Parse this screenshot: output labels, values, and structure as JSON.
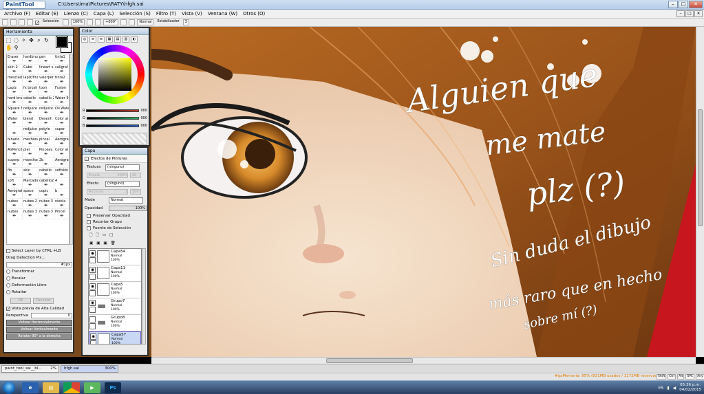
{
  "window": {
    "logo_text": "PaintTool SAI",
    "path": "C:\\Users\\ima\\Pictures\\RATY\\hfgh.sai"
  },
  "menu": [
    "Archivo (F)",
    "Editar (E)",
    "Lienzo (C)",
    "Capa (L)",
    "Selección (S)",
    "Filtro (T)",
    "Vista (V)",
    "Ventana (W)",
    "Otros (O)"
  ],
  "toolbar": {
    "selection_label": "Selección",
    "zoom": "100%",
    "rotation": "+000°",
    "mode": "Normal",
    "stabilizer_label": "Estabilizador",
    "stabilizer_value": "3"
  },
  "tools_panel": {
    "title": "Herramienta",
    "brushes": [
      [
        "Eraser",
        "hardbrus",
        "pen",
        "tinta1"
      ],
      [
        "skin 2",
        "Cubo",
        "lineart s",
        "caligraf Pen"
      ],
      [
        "mesclado",
        "lapiz/fino",
        "valorper",
        "tinta2"
      ],
      [
        "Lapiz",
        "fx brush",
        "toon",
        "Fusion"
      ],
      [
        "hard bru",
        "cabello",
        "cabello 2",
        "Water 9"
      ],
      [
        "Square Brush",
        "redjuice 2mm",
        "redjuice mic",
        "Oil Water"
      ],
      [
        "Water",
        "blend",
        "Desenf.",
        "Color al"
      ],
      [
        "",
        "redjuice",
        "petyle",
        "super"
      ],
      [
        "binario",
        "mechone",
        "pincel",
        "Aerógraf"
      ],
      [
        "AirPencil Pencil",
        "piel",
        "Pinceau",
        "Color al"
      ],
      [
        "superp",
        "manchas",
        "2b",
        "Aerógraf"
      ],
      [
        "fib",
        "skin",
        "cabello",
        "softskin"
      ],
      [
        "soft",
        "Marcado",
        "cabello2",
        "4"
      ],
      [
        "Aerógraf",
        "space",
        "copic",
        "b"
      ],
      [
        "nubes",
        "nubes 2",
        "nubes 3",
        "niebla"
      ],
      [
        "nubes",
        "nubes 3",
        "nubes 3",
        "Pincel"
      ]
    ],
    "select_layer_ctrl": "Select Layer by CTRL +LB",
    "drag_detection": "Drag Detection Pix...",
    "drag_value": "#1px",
    "transform_options": [
      "Transformar",
      "Escalar",
      "Deformación Libre",
      "Rotatiar"
    ],
    "ok": "OK",
    "cancel": "Cancelar",
    "hq_preview": "Vista previa de Alta Calidad",
    "perspective_label": "Perspectiva",
    "perspective_value": "0",
    "flip_h": "Voltear Horizontalmente",
    "flip_v": "Voltear Verticalmente",
    "rotate90": "Rotatar 90° a la derecha"
  },
  "color_panel": {
    "title": "Color",
    "rgb": [
      {
        "label": "R",
        "value": "000",
        "color": "#c0392b"
      },
      {
        "label": "G",
        "value": "000",
        "color": "#27ae60"
      },
      {
        "label": "B",
        "value": "000",
        "color": "#2c5fbf"
      }
    ]
  },
  "layer_panel": {
    "title": "Capa",
    "effects_label": "Efectos de Pinturas",
    "texture_label": "Textura",
    "texture_value": "(ninguno)",
    "scale_label": "Escala",
    "scale_value": "100%",
    "intensity_value": "20",
    "effect_label": "Efecto",
    "effect_value": "(ninguno)",
    "width_label": "Anchura",
    "width_value": "1",
    "width_value2": "100",
    "mode_label": "Mode",
    "mode_value": "Normal",
    "opacity_label": "Opacidad",
    "opacity_value": "100%",
    "preserve": "Preservar Opacidad",
    "clip": "Recortar Grupo",
    "selection_source": "Fuente de Selección",
    "layers": [
      {
        "name": "Capa54",
        "mode": "Normal",
        "opacity": "100%"
      },
      {
        "name": "Capa11",
        "mode": "Normal",
        "opacity": "100%"
      },
      {
        "name": "Capa5",
        "mode": "Normal",
        "opacity": "100%"
      },
      {
        "name": "Grupo7",
        "mode": "Normal",
        "opacity": "100%"
      },
      {
        "name": "Grupo8",
        "mode": "Normal",
        "opacity": "100%"
      },
      {
        "name": "Capa57",
        "mode": "Normal",
        "opacity": "100%"
      }
    ]
  },
  "canvas_text": {
    "line1": "Alguien que",
    "line2": "me mate",
    "line3": "plz (?)",
    "line4": "Sin duda el dibujo",
    "line5": "más raro que en hecho",
    "line6": "sobre mí (?)"
  },
  "file_tabs": [
    {
      "name": "paint_tool_sai__bl...",
      "zoom": "2%"
    },
    {
      "name": "hfgh.sai",
      "zoom": "300%"
    }
  ],
  "status": {
    "memory": "#gaMemoria: 85% (831MB usados / 1172MB reservados)",
    "keys": [
      "Shift",
      "Ctrl",
      "Alt",
      "SPC",
      "Any"
    ]
  },
  "taskbar": {
    "lang": "ES",
    "time": "05:36 p.m.",
    "date": "04/02/2015"
  }
}
